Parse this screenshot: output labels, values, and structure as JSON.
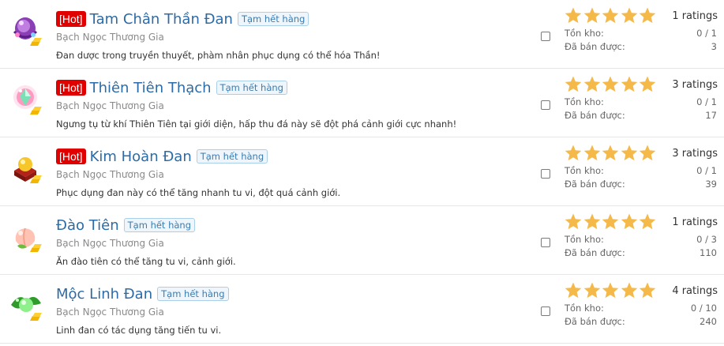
{
  "products": [
    {
      "hot_label": "[Hot]",
      "name": "Tam Chân Thần Đan",
      "status_badge": "Tạm hết hàng",
      "seller": "Bạch Ngọc Thương Gia",
      "description": "Đan dược trong truyền thuyết, phàm nhân phục dụng có thể hóa Thần!",
      "rating_stars": 5,
      "ratings_text": "1 ratings",
      "stock_label": "Tồn kho:",
      "stock_value": "0 / 1",
      "sold_label": "Đã bán được:",
      "sold_value": "3",
      "icon": "purple-elixir-icon"
    },
    {
      "hot_label": "[Hot]",
      "name": "Thiên Tiên Thạch",
      "status_badge": "Tạm hết hàng",
      "seller": "Bạch Ngọc Thương Gia",
      "description": "Ngưng tụ từ khí Thiên Tiên tại giới diện, hấp thu đá này sẽ đột phá cảnh giới cực nhanh!",
      "rating_stars": 5,
      "ratings_text": "3 ratings",
      "stock_label": "Tồn kho:",
      "stock_value": "0 / 1",
      "sold_label": "Đã bán được:",
      "sold_value": "17",
      "icon": "crystal-stone-icon"
    },
    {
      "hot_label": "[Hot]",
      "name": "Kim Hoàn Đan",
      "status_badge": "Tạm hết hàng",
      "seller": "Bạch Ngọc Thương Gia",
      "description": "Phục dụng đan này có thể tăng nhanh tu vi, đột quá cảnh giới.",
      "rating_stars": 5,
      "ratings_text": "3 ratings",
      "stock_label": "Tồn kho:",
      "stock_value": "0 / 1",
      "sold_label": "Đã bán được:",
      "sold_value": "39",
      "icon": "golden-pill-icon"
    },
    {
      "hot_label": "",
      "name": "Đào Tiên",
      "status_badge": "Tạm hết hàng",
      "seller": "Bạch Ngọc Thương Gia",
      "description": "Ăn đào tiên có thể tăng tu vi, cảnh giới.",
      "rating_stars": 5,
      "ratings_text": "1 ratings",
      "stock_label": "Tồn kho:",
      "stock_value": "0 / 3",
      "sold_label": "Đã bán được:",
      "sold_value": "110",
      "icon": "peach-icon"
    },
    {
      "hot_label": "",
      "name": "Mộc Linh Đan",
      "status_badge": "Tạm hết hàng",
      "seller": "Bạch Ngọc Thương Gia",
      "description": "Linh đan có tác dụng tăng tiến tu vi.",
      "rating_stars": 5,
      "ratings_text": "4 ratings",
      "stock_label": "Tồn kho:",
      "stock_value": "0 / 10",
      "sold_label": "Đã bán được:",
      "sold_value": "240",
      "icon": "green-spirit-pill-icon"
    }
  ],
  "colors": {
    "hot": "#e00000",
    "title_link": "#2c6ba6",
    "star": "#f5b94a",
    "badge_border": "#a9cfe9"
  }
}
